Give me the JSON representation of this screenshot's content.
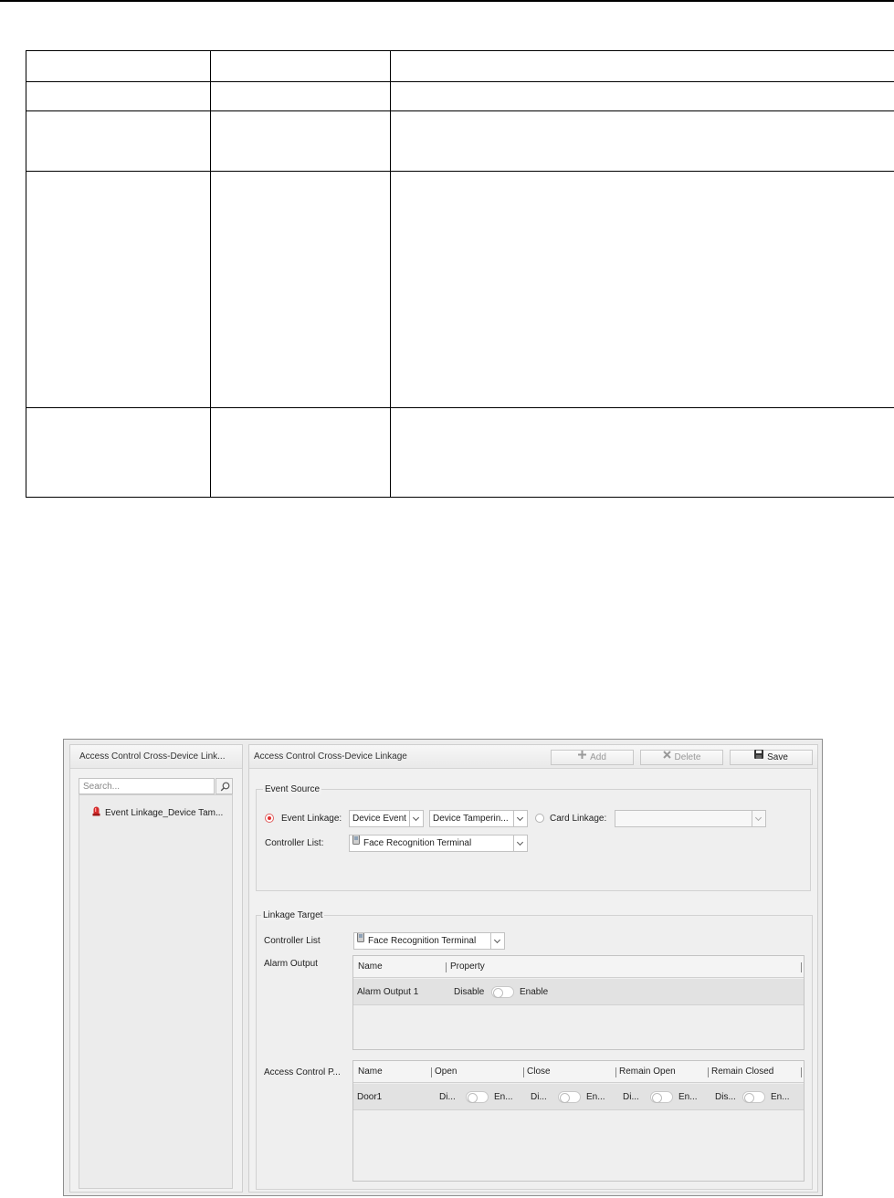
{
  "search": {
    "placeholder": "Search..."
  },
  "left_panel": {
    "title": "Access Control Cross-Device Link...",
    "tree_items": [
      {
        "label": "Event Linkage_Device Tam..."
      }
    ]
  },
  "right_panel": {
    "title": "Access Control Cross-Device Linkage",
    "toolbar": {
      "add_label": "Add",
      "delete_label": "Delete",
      "save_label": "Save"
    },
    "event_source": {
      "title": "Event Source",
      "event_linkage_label": "Event Linkage:",
      "event_type_value": "Device Event",
      "event_value": "Device Tamperin...",
      "card_linkage_label": "Card Linkage:",
      "card_linkage_value": "",
      "controller_list_label": "Controller List:",
      "controller_value": "Face Recognition Terminal"
    },
    "linkage_target": {
      "title": "Linkage Target",
      "controller_list_label": "Controller List",
      "controller_value": "Face Recognition Terminal",
      "alarm_output": {
        "label": "Alarm Output",
        "columns": [
          "Name",
          "Property"
        ],
        "rows": [
          {
            "name": "Alarm Output 1",
            "disable": "Disable",
            "enable": "Enable"
          }
        ]
      },
      "access_control_point": {
        "label": "Access Control P...",
        "columns": [
          "Name",
          "Open",
          "Close",
          "Remain Open",
          "Remain Closed"
        ],
        "rows": [
          {
            "name": "Door1",
            "open": {
              "off": "Di...",
              "on": "En..."
            },
            "close": {
              "off": "Di...",
              "on": "En..."
            },
            "remain_open": {
              "off": "Di...",
              "on": "En..."
            },
            "remain_closed": {
              "off": "Dis...",
              "on": "En..."
            }
          }
        ]
      }
    }
  },
  "colors": {
    "radio_checked": "#e03030",
    "alarm_icon": "#d42a2a"
  }
}
